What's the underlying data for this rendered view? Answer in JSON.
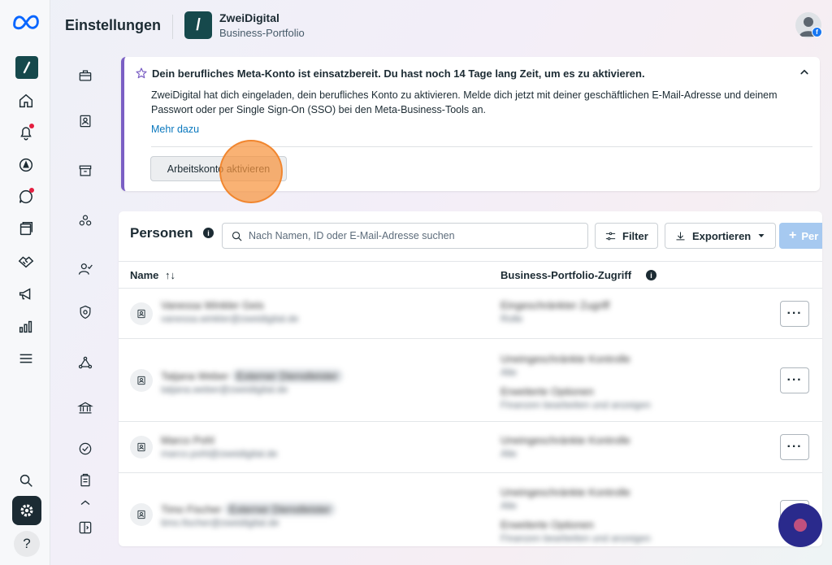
{
  "header": {
    "title": "Einstellungen",
    "portfolio_name": "ZweiDigital",
    "portfolio_type": "Business-Portfolio",
    "logo_glyph": "/"
  },
  "left_rail": {
    "items": [
      {
        "name": "meta-logo",
        "icon": "meta-icon"
      },
      {
        "name": "business-portfolio",
        "icon": "portfolio-icon"
      },
      {
        "name": "home",
        "icon": "home-icon"
      },
      {
        "name": "notifications",
        "icon": "bell-icon",
        "badge": true
      },
      {
        "name": "ads",
        "icon": "compass-icon"
      },
      {
        "name": "messages",
        "icon": "chat-icon",
        "badge": true
      },
      {
        "name": "content",
        "icon": "pages-icon"
      },
      {
        "name": "commerce",
        "icon": "handshake-icon"
      },
      {
        "name": "campaigns",
        "icon": "megaphone-icon"
      },
      {
        "name": "insights",
        "icon": "bar-chart-icon"
      },
      {
        "name": "all-tools",
        "icon": "menu-icon"
      },
      {
        "name": "search",
        "icon": "search-icon"
      },
      {
        "name": "settings",
        "icon": "gear-icon",
        "active": true
      },
      {
        "name": "help",
        "icon": "help-icon",
        "glyph": "?"
      }
    ]
  },
  "banner": {
    "title": "Dein berufliches Meta-Konto ist einsatzbereit. Du hast noch 14 Tage lang Zeit, um es zu aktivieren.",
    "body": "ZweiDigital hat dich eingeladen, dein berufliches Konto zu aktivieren. Melde dich jetzt mit deiner geschäftlichen E-Mail-Adresse und deinem Passwort oder per Single Sign-On (SSO) bei den Meta-Business-Tools an.",
    "link": "Mehr dazu",
    "button": "Arbeitskonto aktivieren",
    "accent": "#7b5fc4"
  },
  "people": {
    "title": "Personen",
    "search_placeholder": "Nach Namen, ID oder E-Mail-Adresse suchen",
    "filter_label": "Filter",
    "export_label": "Exportieren",
    "add_label": "Per",
    "columns": {
      "name": "Name",
      "name_sort": "↑↓",
      "access": "Business-Portfolio-Zugriff"
    },
    "more_glyph": "···",
    "rows": [
      {
        "name": "Vanessa Winkler Geis",
        "tag": "",
        "email": "vanessa.winkler@zweidigital.de",
        "access": [
          {
            "title": "Eingeschränkter Zugriff",
            "sub": "Rolle"
          }
        ]
      },
      {
        "name": "Tatjana Weber",
        "tag": "Externer Dienstleister",
        "email": "tatjana.weber@zweidigital.de",
        "access": [
          {
            "title": "Uneingeschränkte Kontrolle",
            "sub": "Alle"
          },
          {
            "title": "Erweiterte Optionen",
            "sub": "Finanzen bearbeiten und anzeigen"
          }
        ]
      },
      {
        "name": "Marco Pohl",
        "tag": "",
        "email": "marco.pohl@zweidigital.de",
        "access": [
          {
            "title": "Uneingeschränkte Kontrolle",
            "sub": "Alle"
          }
        ]
      },
      {
        "name": "Timo Fischer",
        "tag": "Externer Dienstleister",
        "email": "timo.fischer@zweidigital.de",
        "access": [
          {
            "title": "Uneingeschränkte Kontrolle",
            "sub": "Alle"
          },
          {
            "title": "Erweiterte Optionen",
            "sub": "Finanzen bearbeiten und anzeigen"
          }
        ]
      }
    ]
  },
  "colors": {
    "brand": "#16494c",
    "link": "#0a78be",
    "primary_disabled": "#a6c9f0",
    "click_marker": "#f6943e"
  }
}
